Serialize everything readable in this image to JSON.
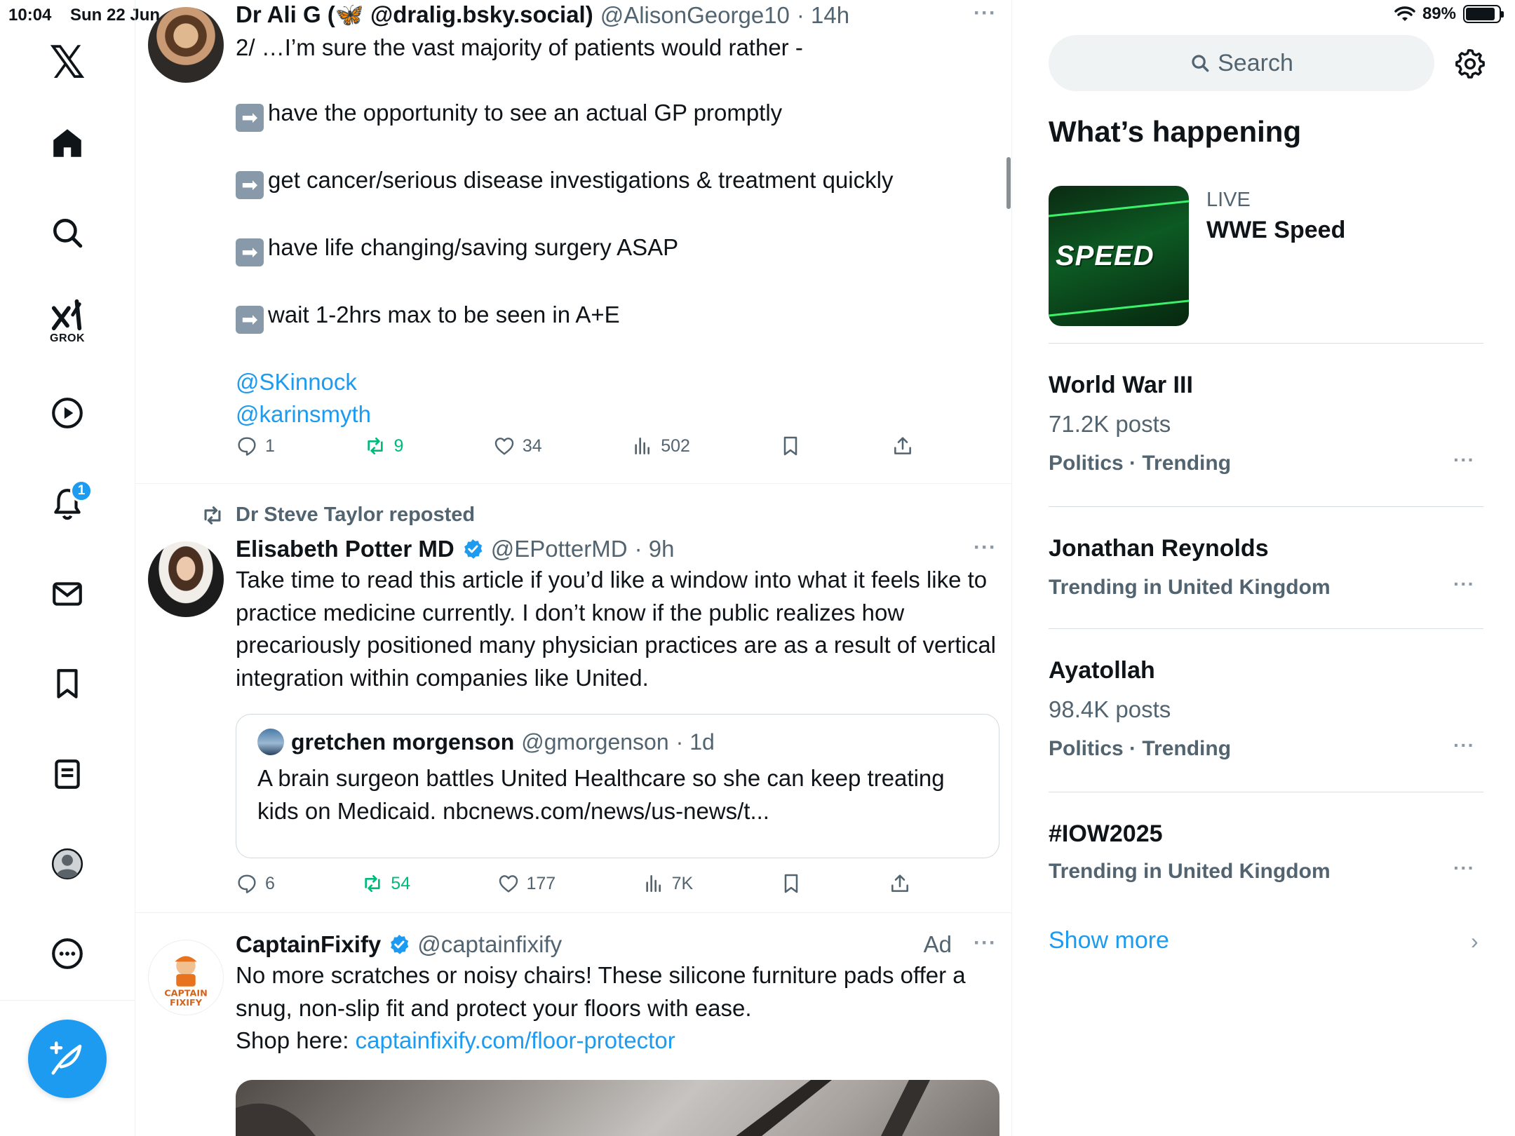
{
  "status_bar": {
    "time": "10:04",
    "date": "Sun 22 Jun",
    "battery": "89%",
    "battery_fraction": 0.89
  },
  "nav": {
    "grok_label": "GROK",
    "notifications_badge": "1"
  },
  "tweets": [
    {
      "name": "Dr Ali G (🦋 @dralig.bsky.social)",
      "handle": "@AlisonGeorge10",
      "time": "· 14h",
      "lines": [
        "2/ …I’m sure the vast majority of patients would rather -",
        "have the opportunity to see an actual GP promptly",
        "get cancer/serious disease investigations  & treatment quickly",
        "have life changing/saving surgery ASAP",
        "wait 1-2hrs max to be seen in A+E"
      ],
      "mentions": [
        "@SKinnock",
        "@karinsmyth"
      ],
      "replies": "1",
      "reposts": "9",
      "likes": "34",
      "views": "502"
    },
    {
      "reposted_by": "Dr Steve Taylor reposted",
      "name": "Elisabeth Potter MD",
      "handle": "@EPotterMD",
      "time": "· 9h",
      "text": "Take time to read this article if you’d like a window into what it feels like to practice medicine currently. I don’t know if the public realizes how precariously positioned many physician practices are as a result of vertical integration within companies like United.",
      "quote": {
        "name": "gretchen morgenson",
        "handle": "@gmorgenson",
        "time": "· 1d",
        "text": "A brain surgeon battles United Healthcare so she can keep treating kids on Medicaid. nbcnews.com/news/us-news/t..."
      },
      "replies": "6",
      "reposts": "54",
      "likes": "177",
      "views": "7K"
    },
    {
      "name": "CaptainFixify",
      "handle": "@captainfixify",
      "ad_label": "Ad",
      "text": "No more scratches or noisy chairs! These silicone furniture pads offer a snug, non-slip fit and protect your floors with ease.",
      "shop_prefix": "Shop here: ",
      "shop_link": "captainfixify.com/floor-protector",
      "avatar_text": "CAPTAIN FIXIFY"
    }
  ],
  "sidebar": {
    "search_placeholder": "Search",
    "section_title": "What’s happening",
    "live": {
      "label": "LIVE",
      "title": "WWE Speed",
      "thumb_text": "SPEED"
    },
    "trends": [
      {
        "name": "World War III",
        "posts": "71.2K posts",
        "meta": "Politics · Trending"
      },
      {
        "name": "Jonathan Reynolds",
        "posts": "",
        "meta": "Trending in United Kingdom"
      },
      {
        "name": "Ayatollah",
        "posts": "98.4K posts",
        "meta": "Politics · Trending"
      },
      {
        "name": "#IOW2025",
        "posts": "",
        "meta": "Trending in United Kingdom"
      }
    ],
    "show_more": "Show more"
  },
  "colors": {
    "accent": "#1d9bf0",
    "repost_green": "#00ba7c",
    "secondary_text": "#536471"
  }
}
